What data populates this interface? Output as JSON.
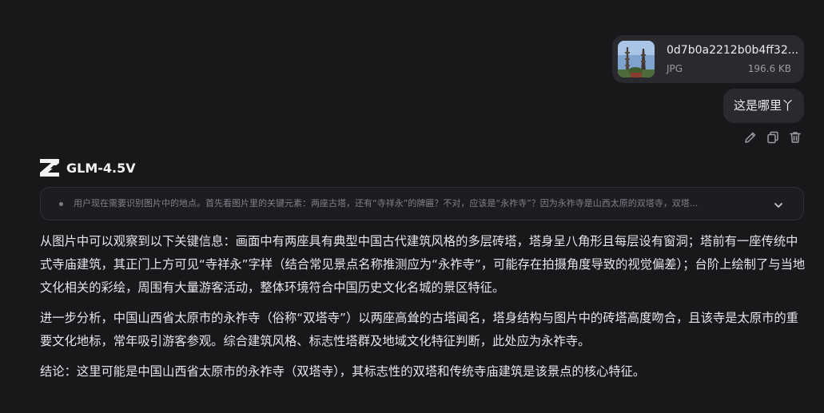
{
  "attachment": {
    "file_name": "0d7b0a2212b0b4ff32...",
    "file_type": "JPG",
    "file_size": "196.6 KB"
  },
  "user_message": {
    "text": "这是哪里丫"
  },
  "message_actions": [
    "edit-icon",
    "copy-icon",
    "delete-icon"
  ],
  "assistant": {
    "model_name": "GLM-4.5V",
    "thinking_preview": "用户现在需要识别图片中的地点。首先看图片里的关键元素：两座古塔，还有“寺祥永”的牌匾？不对，应该是“永祚寺”？因为永祚寺是山西太原的双塔寺，双塔...",
    "paragraphs": [
      "从图片中可以观察到以下关键信息：画面中有两座具有典型中国古代建筑风格的多层砖塔，塔身呈八角形且每层设有窗洞；塔前有一座传统中式寺庙建筑，其正门上方可见“寺祥永”字样（结合常见景点名称推测应为“永祚寺”，可能存在拍摄角度导致的视觉偏差）；台阶上绘制了与当地文化相关的彩绘，周围有大量游客活动，整体环境符合中国历史文化名城的景区特征。",
      "进一步分析，中国山西省太原市的永祚寺（俗称“双塔寺”）以两座高耸的古塔闻名，塔身结构与图片中的砖塔高度吻合，且该寺是太原市的重要文化地标，常年吸引游客参观。综合建筑风格、标志性塔群及地域文化特征判断，此处应为永祚寺。",
      "结论：这里可能是中国山西省太原市的永祚寺（双塔寺），其标志性的双塔和传统寺庙建筑是该景点的核心特征。"
    ]
  },
  "colors": {
    "background": "#18181b",
    "bubble": "#2a2a2e",
    "text": "#e6e6ea",
    "muted": "#80808a"
  }
}
